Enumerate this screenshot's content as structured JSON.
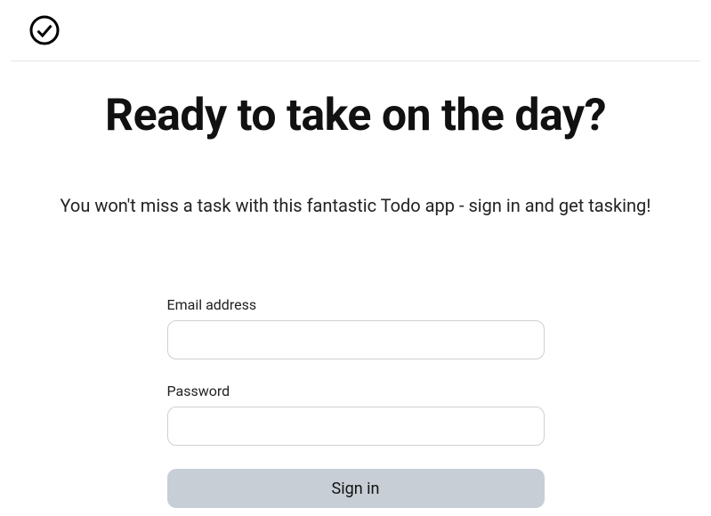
{
  "header": {
    "logo_name": "check-circle-icon"
  },
  "main": {
    "title": "Ready to take on the day?",
    "subtitle": "You won't miss a task with this fantastic Todo app - sign in and get tasking!"
  },
  "form": {
    "email": {
      "label": "Email address",
      "value": "",
      "placeholder": ""
    },
    "password": {
      "label": "Password",
      "value": "",
      "placeholder": ""
    },
    "submit_label": "Sign in"
  }
}
